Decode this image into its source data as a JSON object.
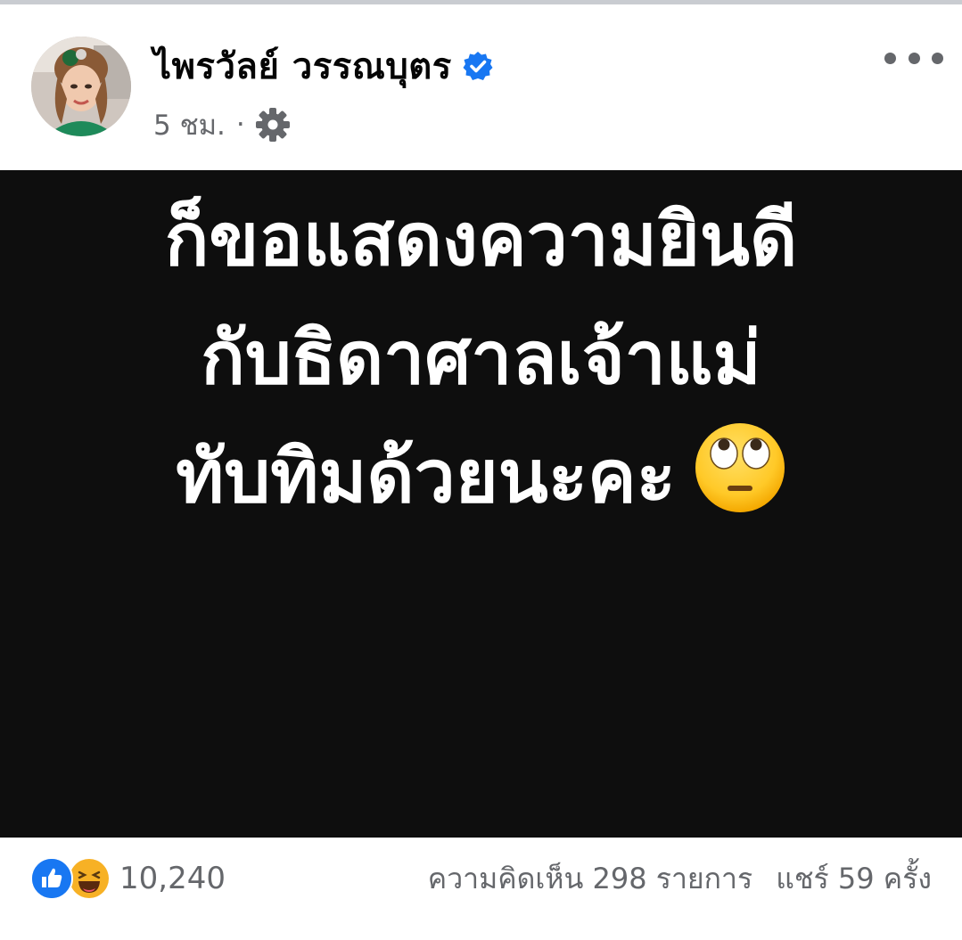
{
  "post": {
    "author_name": "ไพรวัลย์ วรรณบุตร",
    "verified_icon": "verified-badge-icon",
    "timestamp": "5 ชม.",
    "separator": "·",
    "audience_icon": "gear-icon",
    "more_icon": "more-options-icon",
    "image_text_lines": [
      "ก็ขอแสดงความยินดี",
      "กับธิดาศาลเจ้าแม่",
      "ทับทิมด้วยนะคะ"
    ],
    "image_emoji": "face-with-rolling-eyes-icon"
  },
  "footer": {
    "reaction_icons": [
      "like-icon",
      "haha-icon"
    ],
    "reaction_count": "10,240",
    "comments": "ความคิดเห็น 298 รายการ",
    "shares": "แชร์ 59 ครั้ง"
  },
  "colors": {
    "verified_blue": "#1877f2",
    "secondary_text": "#65676b",
    "image_background": "#0e0e0e",
    "image_text": "#ffffff"
  }
}
